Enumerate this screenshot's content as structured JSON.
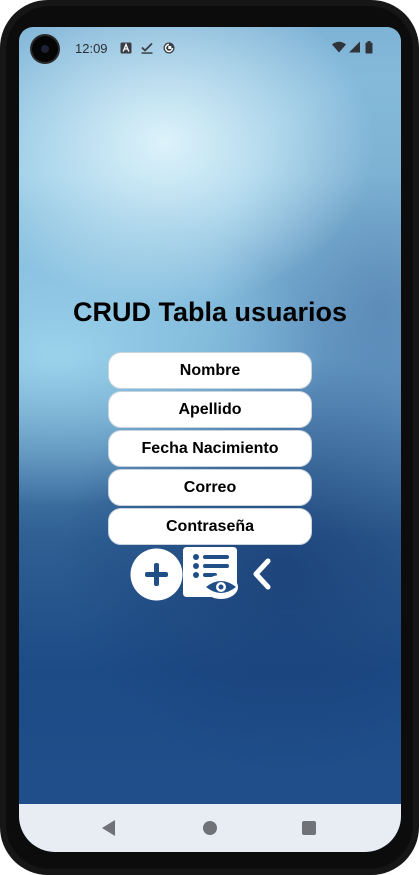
{
  "status_bar": {
    "time": "12:09",
    "left_icons": [
      "font-a-icon",
      "checkmark-icon",
      "sync-icon"
    ],
    "right_icons": [
      "wifi-icon",
      "signal-icon",
      "battery-icon"
    ]
  },
  "main": {
    "title": "CRUD Tabla usuarios",
    "fields": [
      {
        "label": "Nombre"
      },
      {
        "label": "Apellido"
      },
      {
        "label": "Fecha Nacimiento"
      },
      {
        "label": "Correo"
      },
      {
        "label": "Contraseña"
      }
    ],
    "actions": [
      {
        "icon": "add-circle-icon"
      },
      {
        "icon": "view-list-icon"
      },
      {
        "icon": "chevron-left-icon"
      }
    ]
  },
  "nav_bar": {
    "icons": [
      "back-triangle-icon",
      "home-circle-icon",
      "recents-square-icon"
    ]
  },
  "colors": {
    "background_top": "#8ec6e3",
    "background_bottom": "#21508c",
    "button_bg": "#ffffff",
    "text": "#000000",
    "icon_white": "#ffffff"
  }
}
